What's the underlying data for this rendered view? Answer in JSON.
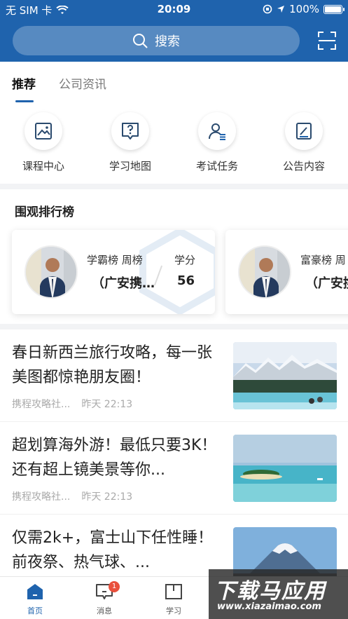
{
  "status_bar": {
    "carrier": "无 SIM 卡",
    "time": "20:09",
    "battery": "100%"
  },
  "header": {
    "search_placeholder": "搜索"
  },
  "tabs": [
    {
      "label": "推荐",
      "active": true
    },
    {
      "label": "公司资讯",
      "active": false
    }
  ],
  "shortcuts": [
    {
      "label": "课程中心",
      "icon": "image-icon"
    },
    {
      "label": "学习地图",
      "icon": "map-question-icon"
    },
    {
      "label": "考试任务",
      "icon": "user-list-icon"
    },
    {
      "label": "公告内容",
      "icon": "edit-note-icon"
    }
  ],
  "ranking": {
    "title": "围观排行榜",
    "cards": [
      {
        "name": "学霸榜 周榜",
        "company": "（广安携…",
        "score_label": "学分",
        "score": "56"
      },
      {
        "name": "富豪榜 周",
        "company": "（广安携",
        "score_label": "",
        "score": ""
      }
    ]
  },
  "news": [
    {
      "title": "春日新西兰旅行攻略，每一张美图都惊艳朋友圈！",
      "source": "携程攻略社...",
      "time": "昨天 22:13"
    },
    {
      "title": "超划算海外游！最低只要3K！还有超上镜美景等你...",
      "source": "携程攻略社...",
      "time": "昨天 22:13"
    },
    {
      "title": "仅需2k+，富士山下任性睡！前夜祭、热气球、...",
      "source": "",
      "time": ""
    }
  ],
  "bottom_nav": [
    {
      "label": "首页",
      "active": true
    },
    {
      "label": "消息",
      "active": false,
      "badge": "1"
    },
    {
      "label": "学习",
      "active": false
    }
  ],
  "watermark": {
    "line1": "下载马应用",
    "line2": "www.xiazaimao.com"
  },
  "colors": {
    "primary": "#1f63ad",
    "badge": "#e9503c"
  }
}
